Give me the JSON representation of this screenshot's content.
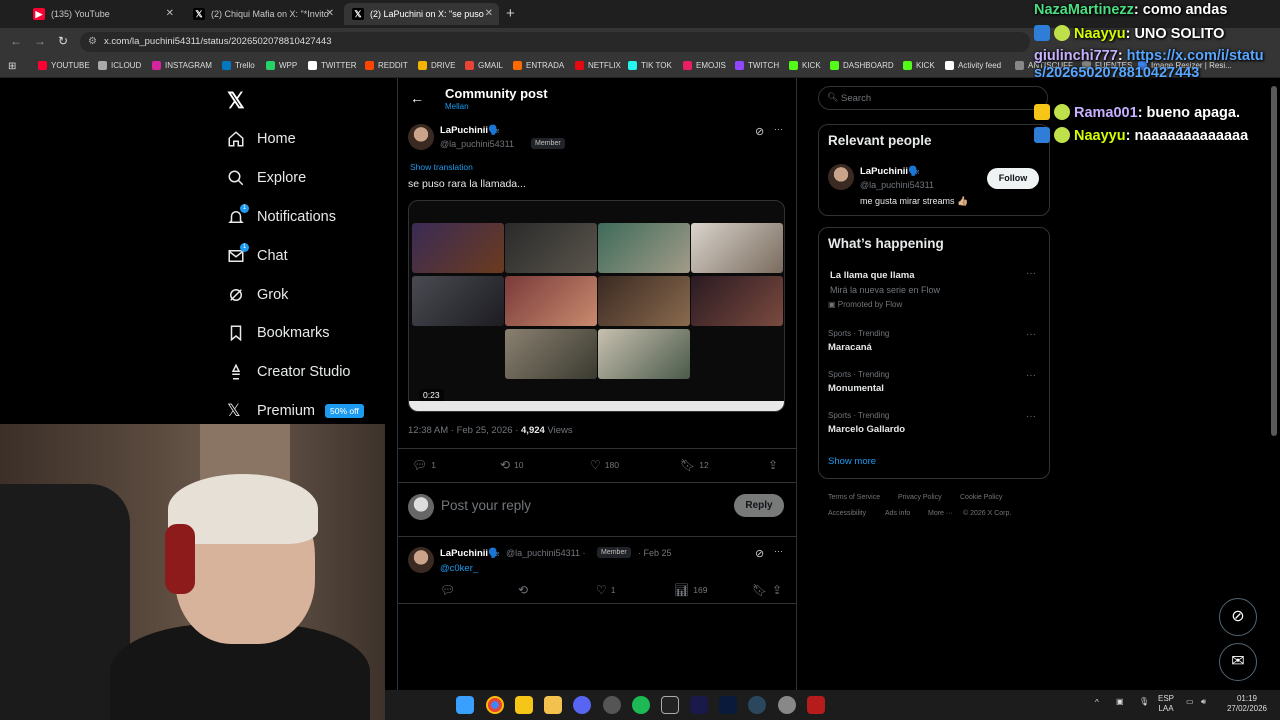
{
  "browser": {
    "tabs": [
      {
        "label": "(135) YouTube"
      },
      {
        "label": "(2) Chiqui Mafia on X: \"*Invito"
      },
      {
        "label": "(2) LaPuchini on X: \"se puso"
      }
    ],
    "url": "x.com/la_puchini54311/status/2026502078810427443",
    "bookmarks": [
      "YOUTUBE",
      "ICLOUD",
      "INSTAGRAM",
      "Trello",
      "WPP",
      "TWITTER",
      "REDDIT",
      "DRIVE",
      "GMAIL",
      "ENTRADA",
      "NETFLIX",
      "TIK TOK",
      "EMOJIS",
      "TWITCH",
      "KICK",
      "DASHBOARD",
      "KICK",
      "Activity feed",
      "ANTISCUFF",
      "FUENTES",
      "Image Resizer | Resi..."
    ]
  },
  "nav": {
    "items": [
      {
        "label": "Home",
        "icon": "home-icon"
      },
      {
        "label": "Explore",
        "icon": "search-icon"
      },
      {
        "label": "Notifications",
        "icon": "bell-icon",
        "badge": "1"
      },
      {
        "label": "Chat",
        "icon": "mail-icon",
        "badge": "1"
      },
      {
        "label": "Grok",
        "icon": "grok-icon"
      },
      {
        "label": "Bookmarks",
        "icon": "bookmark-icon"
      },
      {
        "label": "Creator Studio",
        "icon": "creator-icon"
      },
      {
        "label": "Premium",
        "icon": "x-icon"
      }
    ],
    "premium_promo": "50% off"
  },
  "post": {
    "header_title": "Community post",
    "header_sub": "Mellan",
    "author_name": "LaPuchinii🗣️",
    "author_handle": "@la_puchini54311",
    "member_badge": "Member",
    "show_translation": "Show translation",
    "text": "se puso rara la llamada...",
    "video_duration": "0:23",
    "timestamp": "12:38 AM · Feb 25, 2026 · ",
    "views_count": "4,924",
    "views_label": " Views",
    "replies": "1",
    "reposts": "10",
    "likes": "180",
    "bookmarks": "12"
  },
  "composer": {
    "placeholder": "Post your reply",
    "button": "Reply"
  },
  "reply": {
    "author_name": "LaPuchinii🗣️",
    "author_handle": "@la_puchini54311 ·",
    "member_badge": "Member",
    "date": "· Feb 25",
    "text": "@c0ker_",
    "likes": "1",
    "views": "169"
  },
  "sidebar": {
    "search_placeholder": "Search",
    "relevant_title": "Relevant people",
    "person_name": "LaPuchinii🗣️",
    "person_handle": "@la_puchini54311",
    "person_bio": "me gusta mirar streams 👍🏼",
    "follow_label": "Follow",
    "happening_title": "What’s happening",
    "promo_title": "La llama que llama",
    "promo_desc": "Mirá la nueva serie en Flow",
    "promo_by": "Promoted by Flow",
    "trends": [
      {
        "meta": "Sports · Trending",
        "name": "Maracaná"
      },
      {
        "meta": "Sports · Trending",
        "name": "Monumental"
      },
      {
        "meta": "Sports · Trending",
        "name": "Marcelo Gallardo"
      }
    ],
    "show_more": "Show more",
    "footer_line1": [
      "Terms of Service",
      "Privacy Policy",
      "Cookie Policy"
    ],
    "footer_line2": [
      "Accessibility",
      "Ads info",
      "More ···",
      "© 2026 X Corp."
    ]
  },
  "chat_overlay": [
    {
      "user": "NazaMartinezz",
      "msg": "como andas",
      "color": "#4ade80"
    },
    {
      "user": "Naayyu",
      "msg": "UNO SOLITO",
      "color": "#d4ff00"
    },
    {
      "user": "giulinchi777",
      "msg": "https://x.com/i/status/2026502078810427443",
      "color": "#c7b0ff"
    },
    {
      "user": "Rama001",
      "msg": "bueno apaga.",
      "color": "#c7b0ff"
    },
    {
      "user": "Naayyu",
      "msg": "naaaaaaaaaaaaa",
      "color": "#d4ff00"
    }
  ],
  "taskbar": {
    "lang_top": "ESP",
    "lang_bottom": "LAA",
    "time": "01:19",
    "date": "27/02/2026"
  },
  "colors": {
    "accent": "#1d9bf0",
    "background": "#000000",
    "border": "#2f3336",
    "muted": "#71767b"
  }
}
